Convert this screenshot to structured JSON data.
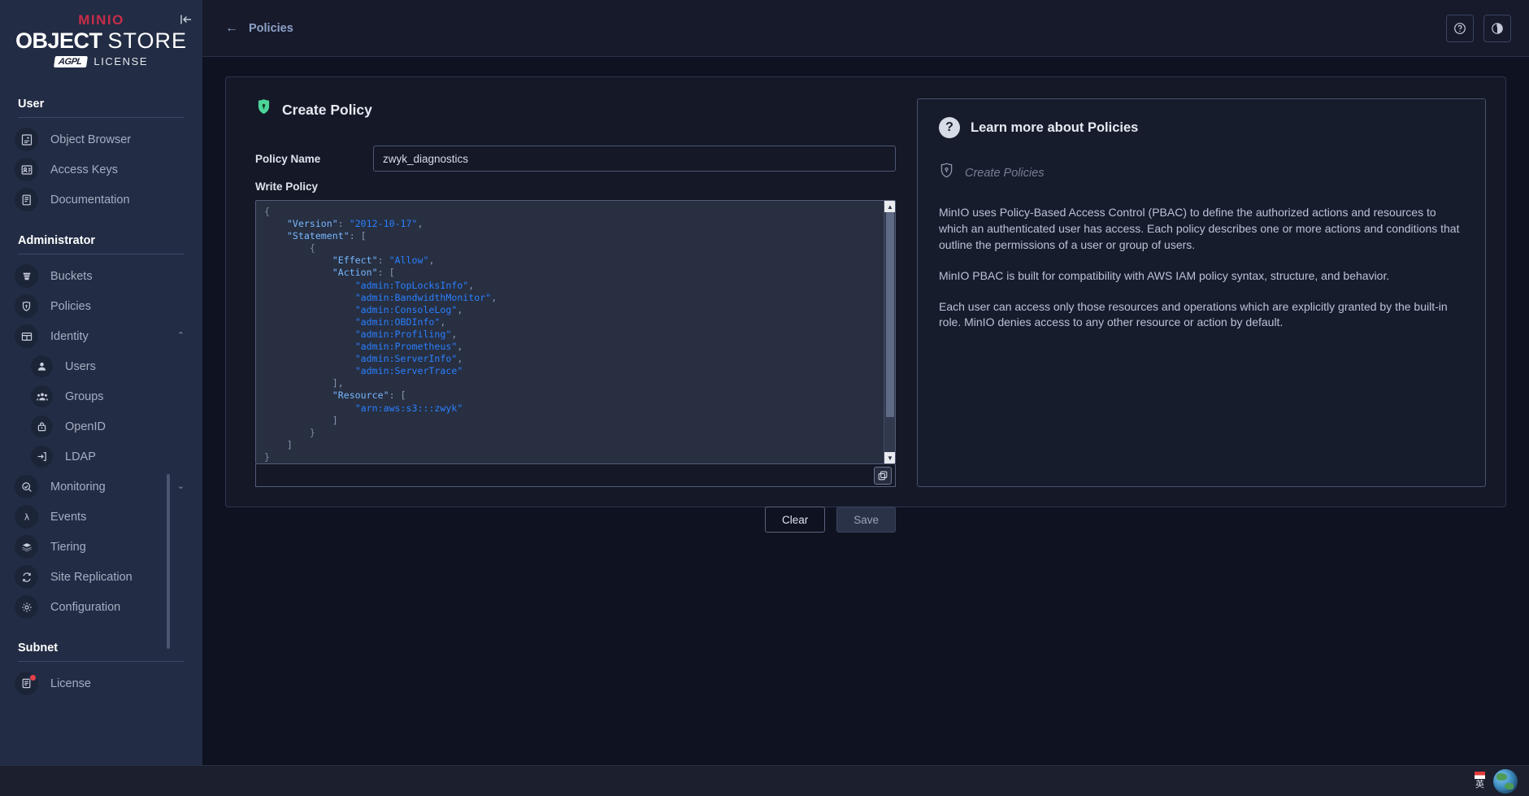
{
  "sidebar": {
    "logo": {
      "brand_prefix": "MIN",
      "brand_suffix": "IO",
      "product_bold": "OBJECT",
      "product_thin": "STORE",
      "license_badge": "AGPL",
      "license_word": "LICENSE"
    },
    "collapse_label": "|←",
    "sections": [
      {
        "title": "User",
        "items": [
          {
            "label": "Object Browser",
            "icon": "object-browser-icon"
          },
          {
            "label": "Access Keys",
            "icon": "access-keys-icon"
          },
          {
            "label": "Documentation",
            "icon": "documentation-icon"
          }
        ]
      },
      {
        "title": "Administrator",
        "items": [
          {
            "label": "Buckets",
            "icon": "buckets-icon"
          },
          {
            "label": "Policies",
            "icon": "policies-icon"
          },
          {
            "label": "Identity",
            "icon": "identity-icon",
            "chevron": "⌃"
          },
          {
            "label": "Users",
            "icon": "user-icon",
            "sub": true
          },
          {
            "label": "Groups",
            "icon": "groups-icon",
            "sub": true
          },
          {
            "label": "OpenID",
            "icon": "openid-icon",
            "sub": true
          },
          {
            "label": "LDAP",
            "icon": "ldap-icon",
            "sub": true
          },
          {
            "label": "Monitoring",
            "icon": "monitoring-icon",
            "chevron": "⌄"
          },
          {
            "label": "Events",
            "icon": "events-icon"
          },
          {
            "label": "Tiering",
            "icon": "tiering-icon"
          },
          {
            "label": "Site Replication",
            "icon": "site-replication-icon"
          },
          {
            "label": "Configuration",
            "icon": "configuration-icon"
          }
        ]
      },
      {
        "title": "Subnet",
        "items": [
          {
            "label": "License",
            "icon": "license-icon",
            "dot": true
          }
        ]
      }
    ]
  },
  "topbar": {
    "breadcrumb": "Policies",
    "back_arrow": "←",
    "help_icon": "help-circle-icon",
    "theme_icon": "dark-mode-icon"
  },
  "form": {
    "title": "Create Policy",
    "policy_name_label": "Policy Name",
    "policy_name_value": "zwyk_diagnostics",
    "policy_name_placeholder": "Policy Name",
    "write_policy_label": "Write Policy",
    "policy_json": "{\n    \"Version\": \"2012-10-17\",\n    \"Statement\": [\n        {\n            \"Effect\": \"Allow\",\n            \"Action\": [\n                \"admin:TopLocksInfo\",\n                \"admin:BandwidthMonitor\",\n                \"admin:ConsoleLog\",\n                \"admin:OBDInfo\",\n                \"admin:Profiling\",\n                \"admin:Prometheus\",\n                \"admin:ServerInfo\",\n                \"admin:ServerTrace\"\n            ],\n            \"Resource\": [\n                \"arn:aws:s3:::zwyk\"\n            ]\n        }\n    ]\n}",
    "policy_document": {
      "version": "2012-10-17",
      "effect": "Allow",
      "actions": [
        "admin:TopLocksInfo",
        "admin:BandwidthMonitor",
        "admin:ConsoleLog",
        "admin:OBDInfo",
        "admin:Profiling",
        "admin:Prometheus",
        "admin:ServerInfo",
        "admin:ServerTrace"
      ],
      "resources": [
        "arn:aws:s3:::zwyk"
      ]
    },
    "copy_icon": "copy-icon",
    "clear_label": "Clear",
    "save_label": "Save"
  },
  "help": {
    "title": "Learn more about Policies",
    "subtitle": "Create Policies",
    "paragraphs": [
      "MinIO uses Policy-Based Access Control (PBAC) to define the authorized actions and resources to which an authenticated user has access. Each policy describes one or more actions and conditions that outline the permissions of a user or group of users.",
      "MinIO PBAC is built for compatibility with AWS IAM policy syntax, structure, and behavior.",
      "Each user can access only those resources and operations which are explicitly granted by the built-in role. MinIO denies access to any other resource or action by default."
    ]
  },
  "taskbar": {
    "ime_label": "英"
  },
  "colors": {
    "sidebar_bg": "#222c44",
    "accent_green": "#4cd49a",
    "brand_red": "#c72c48",
    "link_blue": "#8ea2c8"
  }
}
